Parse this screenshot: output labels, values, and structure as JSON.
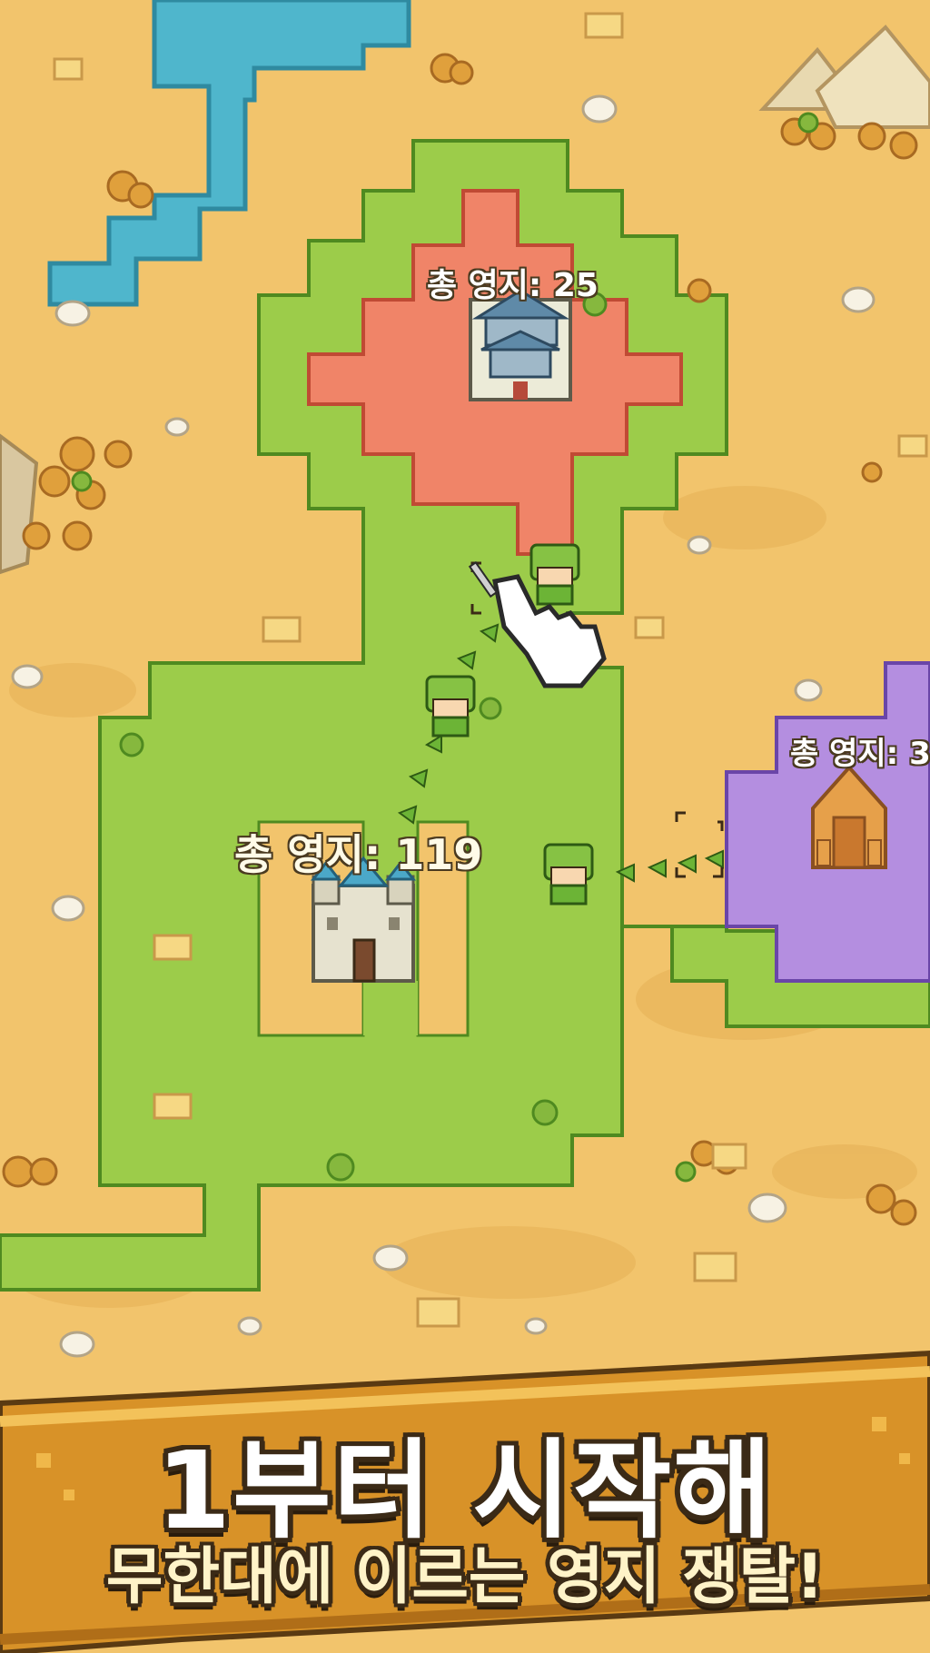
{
  "game": {
    "territories": [
      {
        "id": "enemy-red",
        "label": "총 영지: 25",
        "color": "#f08468"
      },
      {
        "id": "player-green",
        "label": "총 영지: 119",
        "color": "#9ccc4a"
      },
      {
        "id": "enemy-purple",
        "label": "총 영지: 3",
        "color": "#b48ee0"
      }
    ]
  },
  "banner": {
    "title": "1부터 시작해",
    "subtitle": "무한대에 이르는 영지 쟁탈!"
  },
  "colors": {
    "sand": "#f2c46c",
    "grass": "#9ccc4a",
    "red_territory": "#f08468",
    "purple_territory": "#b48ee0",
    "water": "#4fb6cc",
    "banner": "#d89228"
  },
  "icons": [
    "castle-icon",
    "pagoda-castle-icon",
    "pyramid-temple-icon",
    "soldier-icon",
    "pointer-hand-icon",
    "march-arrow-icon"
  ]
}
